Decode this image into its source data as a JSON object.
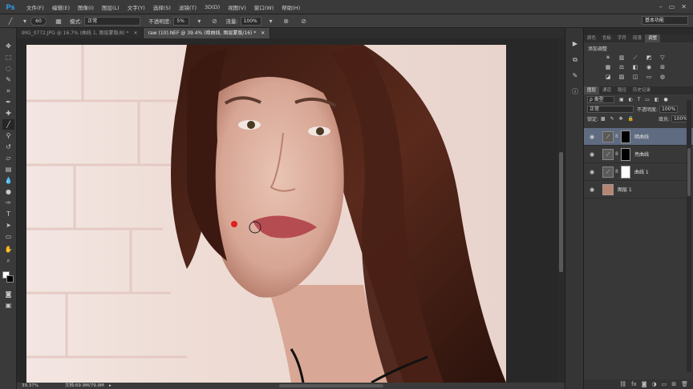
{
  "app": {
    "logo": "Ps"
  },
  "menu": [
    "文件(F)",
    "编辑(E)",
    "图像(I)",
    "图层(L)",
    "文字(Y)",
    "选择(S)",
    "滤镜(T)",
    "3D(D)",
    "视图(V)",
    "窗口(W)",
    "帮助(H)"
  ],
  "window_controls": [
    "–",
    "▭",
    "✕"
  ],
  "options": {
    "brush_size": "60",
    "mode_label": "模式:",
    "mode_value": "正常",
    "opacity_label": "不透明度:",
    "opacity_value": "5%",
    "flow_label": "流量:",
    "flow_value": "100%"
  },
  "workspace": "基本功能",
  "tabs": [
    {
      "label": "IMG_0772.JPG @ 16.7% (曲线 1, 图层蒙版/8) *",
      "close": "✕",
      "active": false
    },
    {
      "label": "raw (10).NEF @ 39.4% (暗曲线, 图层蒙版/16) *",
      "close": "✕",
      "active": true
    }
  ],
  "status": {
    "zoom": "39.37%",
    "doc": "文档:69.9M/79.9M"
  },
  "panel_tabs_top": [
    "颜色",
    "色板",
    "字符",
    "段落",
    "调整"
  ],
  "adjustments": {
    "title": "添加调整"
  },
  "panel_tabs_layers": [
    "图层",
    "通道",
    "路径",
    "历史记录"
  ],
  "layers_panel": {
    "filter_value": "ρ 类型",
    "blend_value": "正常",
    "opacity_label": "不透明度:",
    "opacity_value": "100%",
    "lock_label": "锁定:",
    "fill_label": "填充:",
    "fill_value": "100%"
  },
  "layers": [
    {
      "name": "暗曲线",
      "selected": true,
      "mask_color": "#000000"
    },
    {
      "name": "亮曲线",
      "selected": false,
      "mask_color": "#000000"
    },
    {
      "name": "曲线 1",
      "selected": false,
      "mask_color": "#ffffff"
    },
    {
      "name": "图层 1",
      "selected": false,
      "mask_color": ""
    }
  ],
  "colors": {
    "accent": "#2fa3f7",
    "selected_layer": "#5f6b80",
    "brush_dot": "#e02020"
  }
}
